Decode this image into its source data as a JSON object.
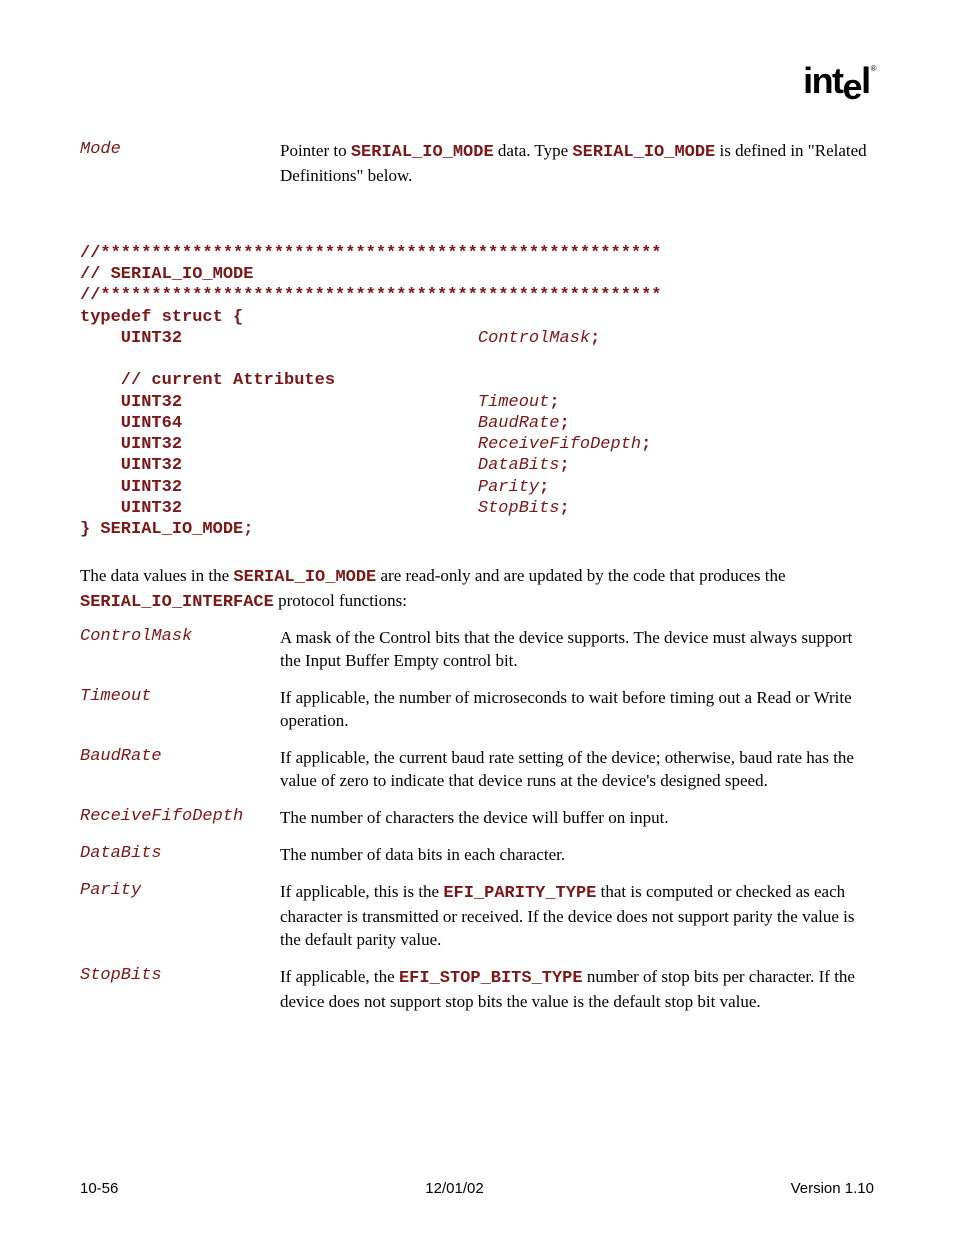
{
  "logo": {
    "text": "intel",
    "reg": "®"
  },
  "topParam": {
    "label": "Mode",
    "desc_pre": "Pointer to ",
    "code1": "SERIAL_IO_MODE",
    "desc_mid": " data.  Type ",
    "code2": "SERIAL_IO_MODE",
    "desc_post": " is defined in \"Related Definitions\" below."
  },
  "codeBlock": {
    "l1": "//*******************************************************",
    "l2": "// SERIAL_IO_MODE",
    "l3": "//*******************************************************",
    "l4": "typedef struct {",
    "l5a": "    UINT32",
    "l5b": "ControlMask",
    "l5c": ";",
    "l6": "",
    "l7": "    // current Attributes",
    "l8a": "    UINT32",
    "l8b": "Timeout",
    "l8c": ";",
    "l9a": "    UINT64",
    "l9b": "BaudRate",
    "l9c": ";",
    "l10a": "    UINT32",
    "l10b": "ReceiveFifoDepth",
    "l10c": ";",
    "l11a": "    UINT32",
    "l11b": "DataBits",
    "l11c": ";",
    "l12a": "    UINT32",
    "l12b": "Parity",
    "l12c": ";",
    "l13a": "    UINT32",
    "l13b": "StopBits",
    "l13c": ";",
    "l14": "} SERIAL_IO_MODE;"
  },
  "para": {
    "p1": "The data values in the ",
    "c1": "SERIAL_IO_MODE",
    "p2": " are read-only and are updated by the code that produces the ",
    "c2": "SERIAL_IO_INTERFACE",
    "p3": " protocol functions:"
  },
  "defs": [
    {
      "label": "ControlMask",
      "desc": "A mask of the Control bits that the device supports.  The device must always support the Input Buffer Empty control bit."
    },
    {
      "label": "Timeout",
      "desc": "If applicable, the number of microseconds to wait before timing out a Read or Write operation."
    },
    {
      "label": "BaudRate",
      "desc": "If applicable, the current baud rate setting of the device; otherwise, baud rate has the value of zero to indicate that device runs at the device's designed speed."
    },
    {
      "label": "ReceiveFifoDepth",
      "desc": "The number of characters the device will buffer on input."
    },
    {
      "label": "DataBits",
      "desc": "The number of data bits in each character."
    },
    {
      "label": "Parity",
      "pre": "If applicable, this is the ",
      "code": "EFI_PARITY_TYPE",
      "post": " that is computed or checked as each character is transmitted or received.  If the device does not support parity the value is the default parity value."
    },
    {
      "label": "StopBits",
      "pre": "If applicable, the ",
      "code": "EFI_STOP_BITS_TYPE",
      "post": " number of stop bits per character.  If the device does not support stop bits the value is the default stop bit value."
    }
  ],
  "footer": {
    "left": "10-56",
    "center": "12/01/02",
    "right": "Version 1.10"
  }
}
